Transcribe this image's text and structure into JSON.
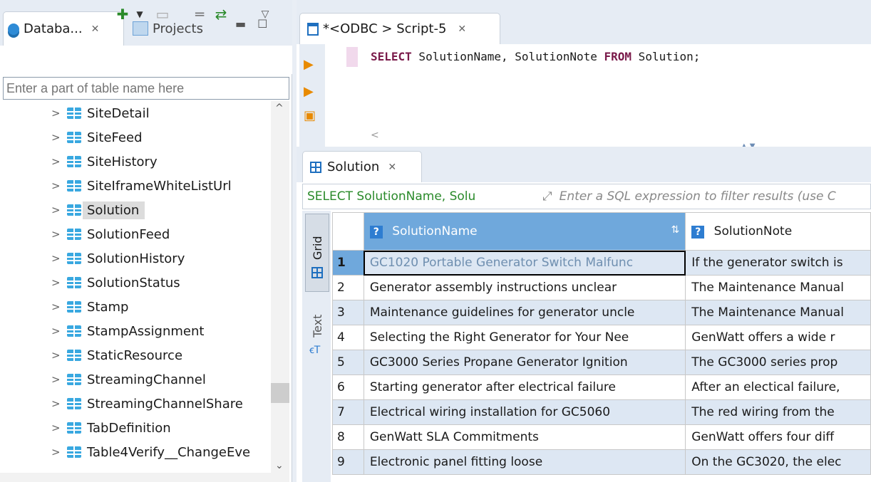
{
  "left_panel": {
    "tab_database": "Databa...",
    "tab_projects": "Projects",
    "filter_placeholder": "Enter a part of table name here",
    "tree_items": [
      "SiteDetail",
      "SiteFeed",
      "SiteHistory",
      "SiteIframeWhiteListUrl",
      "Solution",
      "SolutionFeed",
      "SolutionHistory",
      "SolutionStatus",
      "Stamp",
      "StampAssignment",
      "StaticResource",
      "StreamingChannel",
      "StreamingChannelShare",
      "TabDefinition",
      "Table4Verify__ChangeEve"
    ],
    "selected_item": "Solution"
  },
  "editor": {
    "tab_title": "*<ODBC > Script-5",
    "sql_kw1": "SELECT",
    "sql_mid": " SolutionName, SolutionNote ",
    "sql_kw2": "FROM",
    "sql_end": " Solution;"
  },
  "results": {
    "tab_title": "Solution",
    "filter_query": "SELECT SolutionName, Solu",
    "filter_placeholder": "Enter a SQL expression to filter results (use C",
    "view_grid": "Grid",
    "view_text": "Text",
    "columns": [
      "SolutionName",
      "SolutionNote"
    ],
    "rows": [
      {
        "n": "1",
        "name": "GC1020 Portable Generator Switch Malfunc",
        "note": "If the generator switch is"
      },
      {
        "n": "2",
        "name": "Generator assembly instructions unclear",
        "note": "The Maintenance Manual"
      },
      {
        "n": "3",
        "name": "Maintenance guidelines for generator uncle",
        "note": "The Maintenance Manual"
      },
      {
        "n": "4",
        "name": "Selecting the Right Generator for Your Nee",
        "note": "GenWatt offers a wide r"
      },
      {
        "n": "5",
        "name": "GC3000 Series Propane Generator Ignition",
        "note": "The GC3000 series prop"
      },
      {
        "n": "6",
        "name": "Starting generator after electrical failure",
        "note": "After an electical failure,"
      },
      {
        "n": "7",
        "name": "Electrical wiring installation for GC5060",
        "note": "The red wiring from the"
      },
      {
        "n": "8",
        "name": "GenWatt SLA Commitments",
        "note": "GenWatt offers four diff"
      },
      {
        "n": "9",
        "name": "Electronic panel fitting loose",
        "note": "On the GC3020, the elec"
      }
    ]
  }
}
